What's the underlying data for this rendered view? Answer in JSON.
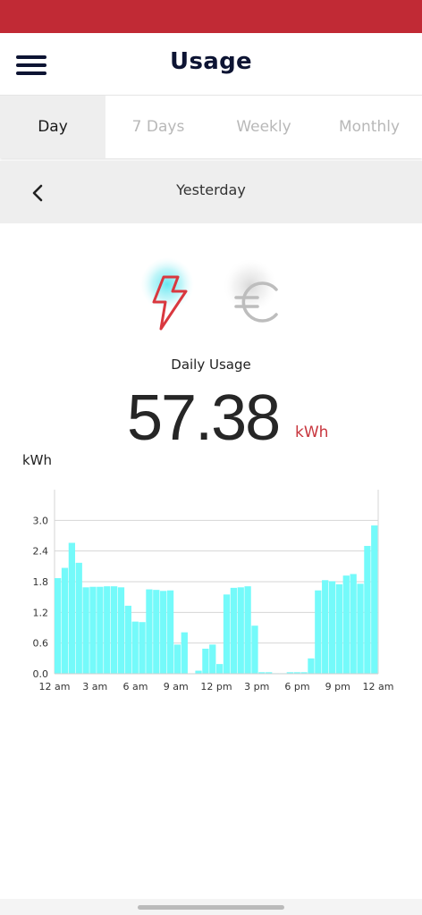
{
  "header": {
    "title": "Usage",
    "menu_icon": "hamburger-menu-icon"
  },
  "tabs": [
    {
      "label": "Day",
      "active": true
    },
    {
      "label": "7 Days",
      "active": false
    },
    {
      "label": "Weekly",
      "active": false
    },
    {
      "label": "Monthly",
      "active": false
    }
  ],
  "date_nav": {
    "label": "Yesterday",
    "back_icon": "chevron-left-icon"
  },
  "modes": [
    {
      "icon": "lightning-bolt-icon",
      "selected": true
    },
    {
      "icon": "euro-icon",
      "selected": false
    }
  ],
  "summary": {
    "label": "Daily Usage",
    "value": "57.38",
    "unit": "kWh"
  },
  "colors": {
    "brand": "#c12a35",
    "bar": "#74fafa",
    "navy": "#0d1433",
    "unit_red": "#c8363e"
  },
  "chart_data": {
    "type": "bar",
    "ylabel": "kWh",
    "ylim": [
      0,
      3.6
    ],
    "yticks": [
      "0.0",
      "0.6",
      "1.2",
      "1.8",
      "2.4",
      "3.0"
    ],
    "xticks": [
      "12 am",
      "3 am",
      "6 am",
      "9 am",
      "12 pm",
      "3 pm",
      "6 pm",
      "9 pm",
      "12 am"
    ],
    "grid": true,
    "values": [
      1.87,
      2.07,
      2.56,
      2.17,
      1.69,
      1.7,
      1.7,
      1.71,
      1.71,
      1.69,
      1.33,
      1.02,
      1.01,
      1.65,
      1.64,
      1.62,
      1.63,
      0.57,
      0.81,
      0.0,
      0.06,
      0.49,
      0.57,
      0.19,
      1.55,
      1.68,
      1.69,
      1.71,
      0.94,
      0.03,
      0.03,
      0.01,
      0.01,
      0.03,
      0.03,
      0.03,
      0.3,
      1.63,
      1.83,
      1.81,
      1.75,
      1.92,
      1.95,
      1.76,
      2.5,
      2.9
    ]
  }
}
